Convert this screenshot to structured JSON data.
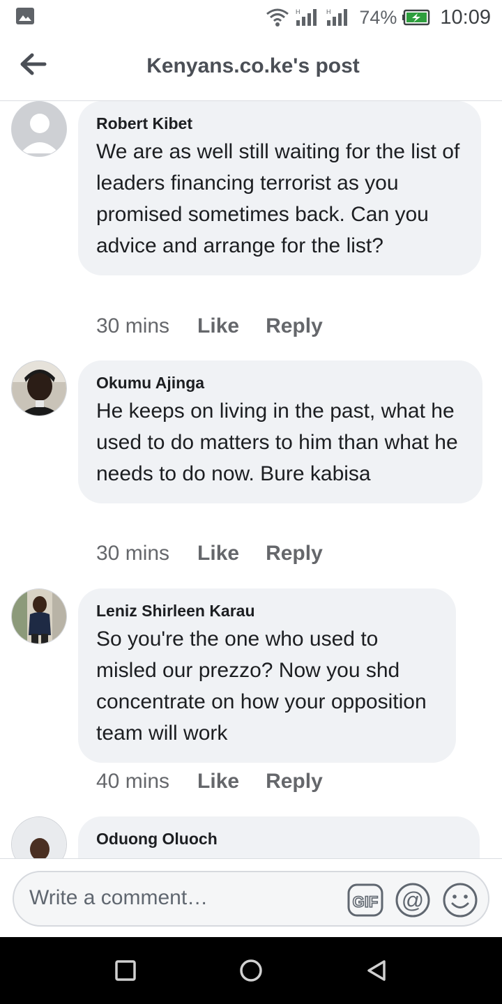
{
  "status_bar": {
    "battery_pct": "74%",
    "time": "10:09",
    "icons": [
      "gallery-icon",
      "wifi-icon",
      "signal-icon",
      "signal-icon",
      "battery-charging-icon"
    ]
  },
  "header": {
    "title": "Kenyans.co.ke's post",
    "back_icon": "arrow-left-icon"
  },
  "comments": [
    {
      "author": "Robert Kibet",
      "text": "We are as well still waiting for the list of leaders financing terrorist as you promised sometimes back. Can you advice and arrange for the list?",
      "time": "30 mins",
      "like": "Like",
      "reply": "Reply"
    },
    {
      "author": "Okumu Ajinga",
      "text": "He keeps on living in the past, what he used to do matters to him than what he needs to do now. Bure kabisa",
      "time": "30 mins",
      "like": "Like",
      "reply": "Reply"
    },
    {
      "author": "Leniz Shirleen Karau",
      "text": "So you're the one who used to misled our prezzo? Now you shd concentrate on how your opposition team will work",
      "time": "40 mins",
      "like": "Like",
      "reply": "Reply"
    },
    {
      "author": "Oduong Oluoch"
    }
  ],
  "composer": {
    "placeholder": "Write a comment…",
    "icons": [
      "gif-icon",
      "at-mention-icon",
      "emoji-icon"
    ]
  },
  "navbar": {
    "icons": [
      "recents-square-icon",
      "home-circle-icon",
      "back-triangle-icon"
    ]
  },
  "colors": {
    "bubble": "#f0f2f5",
    "meta_text": "#65676b",
    "navbar": "#000000"
  }
}
